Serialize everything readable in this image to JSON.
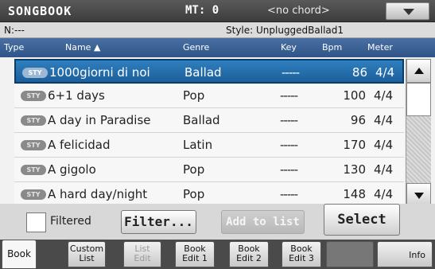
{
  "titlebar": {
    "title": "SONGBOOK",
    "mt": "MT: 0",
    "chord": "<no chord>"
  },
  "infoline": {
    "n": "N:---",
    "style": "Style: UnpluggedBallad1"
  },
  "columns": {
    "type": "Type",
    "name": "Name ▲",
    "genre": "Genre",
    "key": "Key",
    "bpm": "Bpm",
    "meter": "Meter"
  },
  "rows": [
    {
      "badge": "STY",
      "name": "1000giorni di noi",
      "genre": "Ballad",
      "key": "-----",
      "bpm": "86",
      "meter": "4/4"
    },
    {
      "badge": "STY",
      "name": "6+1 days",
      "genre": "Pop",
      "key": "-----",
      "bpm": "100",
      "meter": "4/4"
    },
    {
      "badge": "STY",
      "name": "A day in Paradise",
      "genre": "Ballad",
      "key": "-----",
      "bpm": "96",
      "meter": "4/4"
    },
    {
      "badge": "STY",
      "name": "A felicidad",
      "genre": "Latin",
      "key": "-----",
      "bpm": "170",
      "meter": "4/4"
    },
    {
      "badge": "STY",
      "name": "A gigolo",
      "genre": "Pop",
      "key": "-----",
      "bpm": "130",
      "meter": "4/4"
    },
    {
      "badge": "STY",
      "name": "A hard day/night",
      "genre": "Pop",
      "key": "-----",
      "bpm": "148",
      "meter": "4/4"
    }
  ],
  "controls": {
    "filtered": "Filtered",
    "filter": "Filter...",
    "add_to_list": "Add to list",
    "select": "Select"
  },
  "tabs": {
    "book": "Book",
    "custom_list_1": "Custom",
    "custom_list_2": "List",
    "list_edit_1": "List",
    "list_edit_2": "Edit",
    "book_edit1_1": "Book",
    "book_edit1_2": "Edit 1",
    "book_edit2_1": "Book",
    "book_edit2_2": "Edit 2",
    "book_edit3_1": "Book",
    "book_edit3_2": "Edit 3",
    "info": "Info"
  },
  "colors": {
    "selection": "#1c5f9c",
    "header": "#2e5488"
  }
}
